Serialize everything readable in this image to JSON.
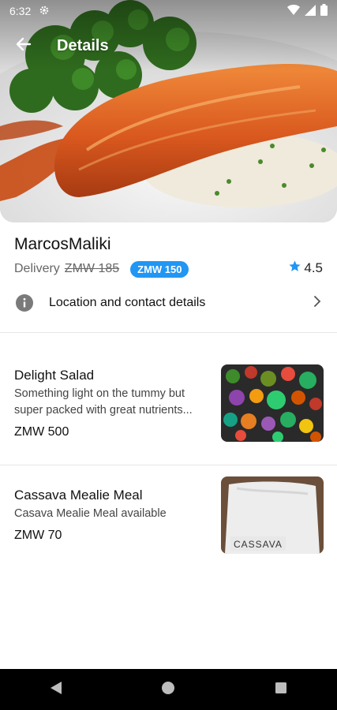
{
  "status_bar": {
    "time": "6:32"
  },
  "app_bar": {
    "title": "Details"
  },
  "restaurant": {
    "name": "MarcosMaliki",
    "delivery_label": "Delivery",
    "delivery_old_price": "ZMW 185",
    "delivery_new_price": "ZMW 150",
    "rating": "4.5"
  },
  "location_row": {
    "label": "Location and contact details"
  },
  "menu_items": [
    {
      "name": "Delight Salad",
      "description": "Something light on the tummy but super packed with great nutrients...",
      "price": "ZMW 500"
    },
    {
      "name": "Cassava Mealie Meal",
      "description": "Casava Mealie Meal available",
      "price": "ZMW 70"
    }
  ],
  "colors": {
    "accent": "#2196f3",
    "navbar": "#000000"
  }
}
